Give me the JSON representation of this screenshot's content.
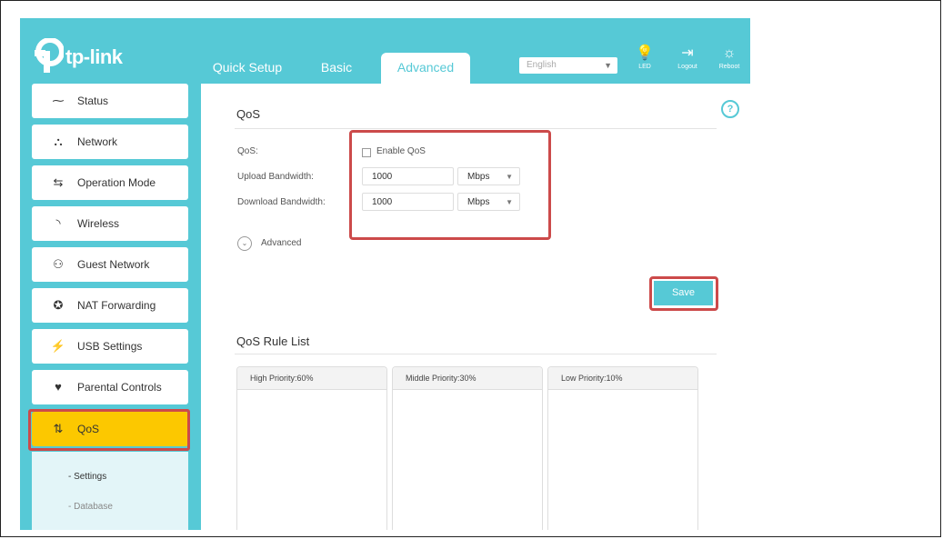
{
  "brand": {
    "logo_text": "tp-link"
  },
  "tabs": {
    "quick_setup": "Quick Setup",
    "basic": "Basic",
    "advanced": "Advanced"
  },
  "header": {
    "language": "English",
    "led_label": "LED",
    "logout_label": "Logout",
    "reboot_label": "Reboot"
  },
  "sidebar": {
    "items": [
      {
        "label": "Status",
        "icon": "pulse-icon"
      },
      {
        "label": "Network",
        "icon": "network-icon"
      },
      {
        "label": "Operation Mode",
        "icon": "operation-mode-icon"
      },
      {
        "label": "Wireless",
        "icon": "wifi-icon"
      },
      {
        "label": "Guest Network",
        "icon": "guest-icon"
      },
      {
        "label": "NAT Forwarding",
        "icon": "nat-icon"
      },
      {
        "label": "USB Settings",
        "icon": "usb-icon"
      },
      {
        "label": "Parental Controls",
        "icon": "heart-icon"
      },
      {
        "label": "QoS",
        "icon": "arrows-updown-icon",
        "active": true
      }
    ],
    "sub_items": [
      "- Settings",
      "- Database"
    ]
  },
  "qos": {
    "title": "QoS",
    "qos_label": "QoS:",
    "enable_label": "Enable QoS",
    "enable_checked": false,
    "upload_label": "Upload Bandwidth:",
    "upload_value": "1000",
    "upload_unit": "Mbps",
    "download_label": "Download Bandwidth:",
    "download_value": "1000",
    "download_unit": "Mbps",
    "advanced_label": "Advanced",
    "save_label": "Save"
  },
  "rule_list": {
    "title": "QoS Rule List",
    "columns": [
      "High Priority:60%",
      "Middle Priority:30%",
      "Low Priority:10%"
    ]
  },
  "colors": {
    "accent": "#56c9d6",
    "active": "#fcc800",
    "highlight": "#cc4a4a"
  }
}
